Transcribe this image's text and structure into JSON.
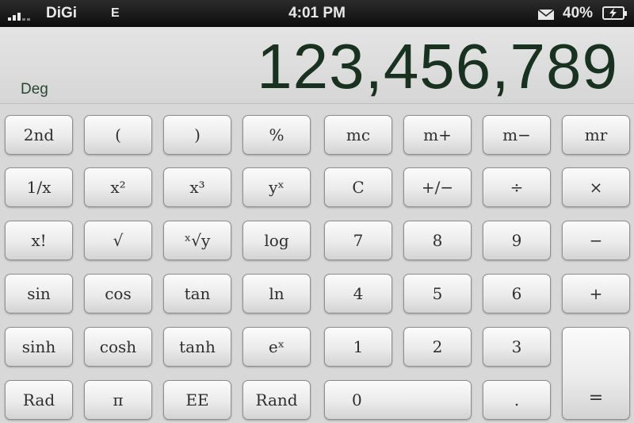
{
  "status_bar": {
    "carrier": "DiGi",
    "network": "E",
    "time": "4:01 PM",
    "battery": "40%",
    "icons": [
      "signal-icon",
      "mail-icon",
      "battery-charging-icon"
    ]
  },
  "display": {
    "value": "123,456,789",
    "angle_mode": "Deg"
  },
  "keys": [
    [
      "2nd",
      "(",
      ")",
      "%",
      "mc",
      "m+",
      "m−",
      "mr"
    ],
    [
      "1/x",
      "x²",
      "x³",
      "yˣ",
      "C",
      "+/−",
      "÷",
      "×"
    ],
    [
      "x!",
      "√",
      "ˣ√y",
      "log",
      "7",
      "8",
      "9",
      "−"
    ],
    [
      "sin",
      "cos",
      "tan",
      "ln",
      "4",
      "5",
      "6",
      "+"
    ],
    [
      "sinh",
      "cosh",
      "tanh",
      "eˣ",
      "1",
      "2",
      "3"
    ],
    [
      "Rad",
      "π",
      "EE",
      "Rand",
      "0",
      "."
    ]
  ],
  "equals_key": "=",
  "colors": {
    "display_text": "#17331f",
    "status_bar": "#111111",
    "keypad_bg": "#d8d8d8"
  }
}
